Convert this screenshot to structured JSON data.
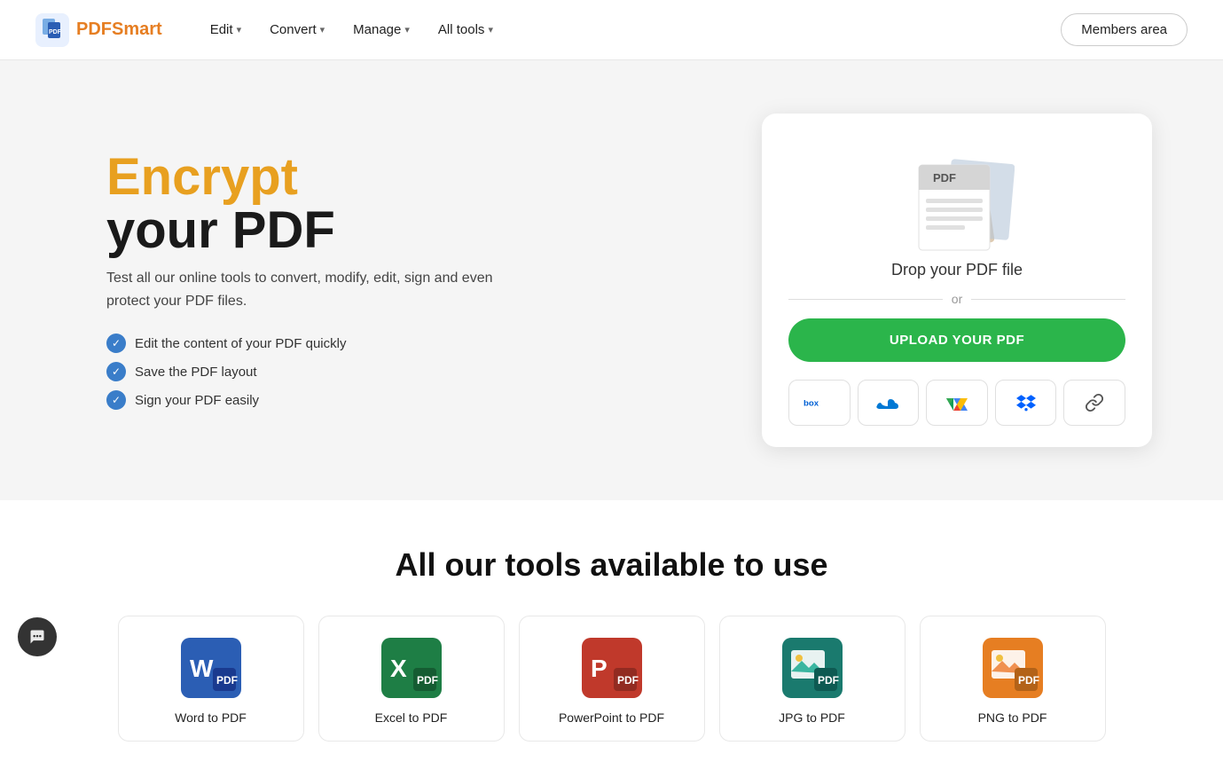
{
  "nav": {
    "logo_text_prefix": "PDF",
    "logo_text_suffix": "Smart",
    "links": [
      {
        "label": "Edit",
        "id": "edit"
      },
      {
        "label": "Convert",
        "id": "convert"
      },
      {
        "label": "Manage",
        "id": "manage"
      },
      {
        "label": "All tools",
        "id": "all-tools"
      }
    ],
    "members_label": "Members area"
  },
  "hero": {
    "title_highlight": "Encrypt",
    "title_normal": "your PDF",
    "subtitle": "Test all our online tools to convert, modify, edit, sign and even protect your PDF files.",
    "checks": [
      "Edit the content of your PDF quickly",
      "Save the PDF layout",
      "Sign your PDF easily"
    ],
    "drop_label": "Drop your PDF file",
    "divider_or": "or",
    "upload_btn_label": "UPLOAD YOUR PDF",
    "cloud_icons": [
      {
        "id": "box",
        "label": "box"
      },
      {
        "id": "onedrive",
        "label": "cloud"
      },
      {
        "id": "gdrive",
        "label": "gdrive"
      },
      {
        "id": "dropbox",
        "label": "dropbox"
      },
      {
        "id": "link",
        "label": "link"
      }
    ]
  },
  "tools_section": {
    "title": "All our tools available to use",
    "tools": [
      {
        "label": "Word to PDF",
        "id": "word-to-pdf",
        "color": "#2b5eb4",
        "accent": "#1a3a8f"
      },
      {
        "label": "Excel to PDF",
        "id": "excel-to-pdf",
        "color": "#1e7e45",
        "accent": "#155c32"
      },
      {
        "label": "PowerPoint to PDF",
        "id": "ppt-to-pdf",
        "color": "#c0392b",
        "accent": "#922b21"
      },
      {
        "label": "JPG to PDF",
        "id": "jpg-to-pdf",
        "color": "#1a7a6e",
        "accent": "#0e5a52"
      },
      {
        "label": "PNG to PDF",
        "id": "png-to-pdf",
        "color": "#e67e22",
        "accent": "#b36218"
      }
    ]
  },
  "chat": {
    "icon": "💬"
  },
  "colors": {
    "highlight": "#e8a020",
    "upload_btn": "#2bb54b",
    "check_circle": "#3a7dc9"
  }
}
